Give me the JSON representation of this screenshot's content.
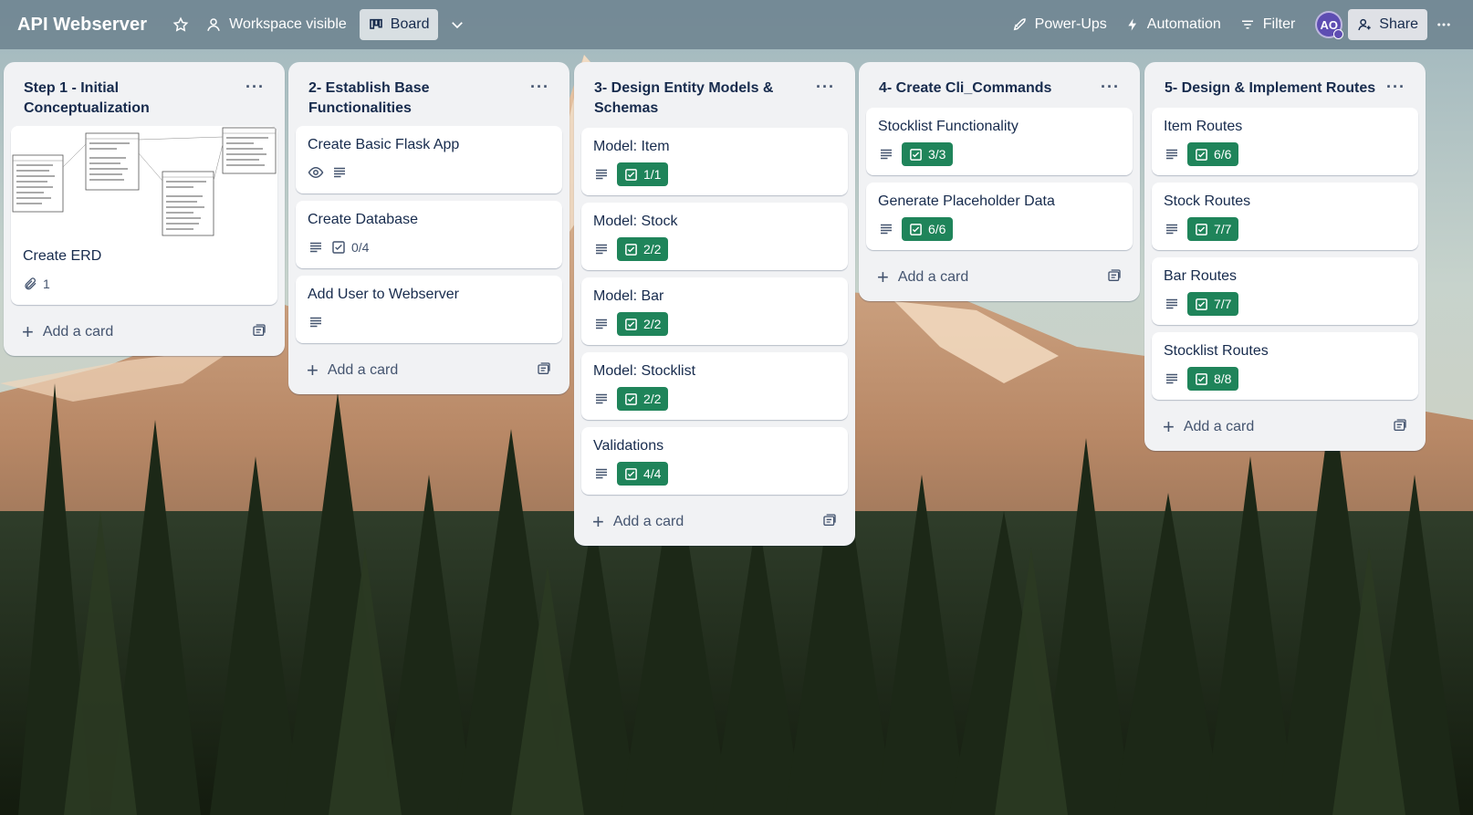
{
  "board": {
    "title": "API Webserver",
    "visibility_label": "Workspace visible",
    "view_label": "Board"
  },
  "header_right": {
    "powerups_label": "Power-Ups",
    "automation_label": "Automation",
    "filter_label": "Filter",
    "avatar_initials": "AO",
    "share_label": "Share"
  },
  "colors": {
    "checklist_complete": "#1f845a",
    "list_bg": "#f1f2f4",
    "avatar": "#5e4db2"
  },
  "lists": [
    {
      "title": "Step 1 - Initial Conceptualization",
      "add_label": "Add a card",
      "cards": [
        {
          "title": "Create ERD",
          "attachments": "1"
        }
      ]
    },
    {
      "title": "2- Establish Base Functionalities",
      "add_label": "Add a card",
      "cards": [
        {
          "title": "Create Basic Flask App"
        },
        {
          "title": "Create Database",
          "checklist": "0/4"
        },
        {
          "title": "Add User to Webserver"
        }
      ]
    },
    {
      "title": "3- Design Entity Models & Schemas",
      "add_label": "Add a card",
      "cards": [
        {
          "title": "Model: Item",
          "checklist": "1/1"
        },
        {
          "title": "Model: Stock",
          "checklist": "2/2"
        },
        {
          "title": "Model: Bar",
          "checklist": "2/2"
        },
        {
          "title": "Model: Stocklist",
          "checklist": "2/2"
        },
        {
          "title": "Validations",
          "checklist": "4/4"
        }
      ]
    },
    {
      "title": "4- Create Cli_Commands",
      "add_label": "Add a card",
      "cards": [
        {
          "title": "Stocklist Functionality",
          "checklist": "3/3"
        },
        {
          "title": "Generate Placeholder Data",
          "checklist": "6/6"
        }
      ]
    },
    {
      "title": "5- Design & Implement Routes",
      "add_label": "Add a card",
      "cards": [
        {
          "title": "Item Routes",
          "checklist": "6/6"
        },
        {
          "title": "Stock Routes",
          "checklist": "7/7"
        },
        {
          "title": "Bar Routes",
          "checklist": "7/7"
        },
        {
          "title": "Stocklist Routes",
          "checklist": "8/8"
        }
      ]
    }
  ]
}
